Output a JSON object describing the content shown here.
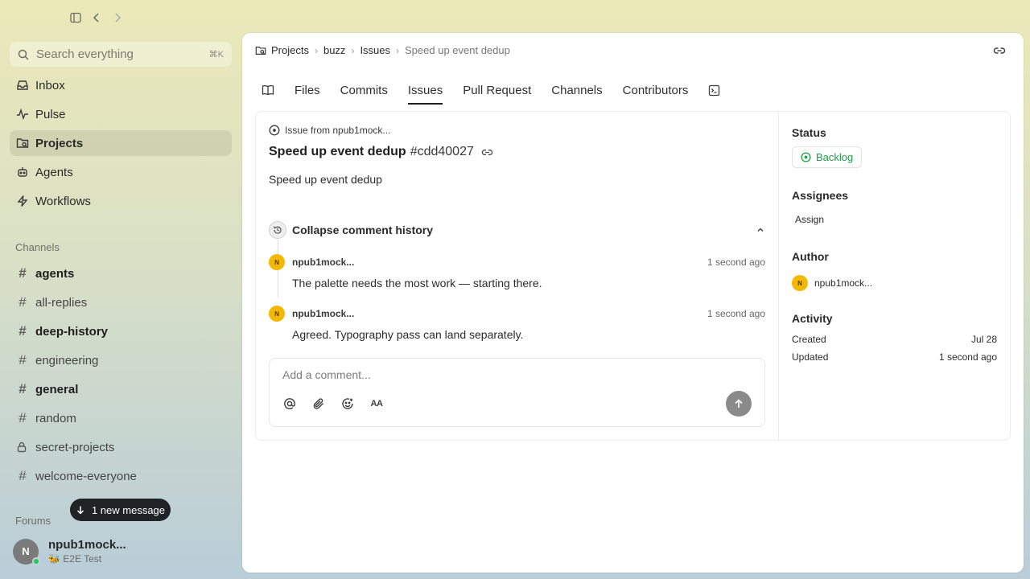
{
  "sidebar": {
    "search_placeholder": "Search everything",
    "search_shortcut": "⌘K",
    "nav": [
      {
        "label": "Inbox",
        "icon": "inbox-icon"
      },
      {
        "label": "Pulse",
        "icon": "pulse-icon"
      },
      {
        "label": "Projects",
        "icon": "projects-icon",
        "active": true
      },
      {
        "label": "Agents",
        "icon": "agents-icon"
      },
      {
        "label": "Workflows",
        "icon": "workflows-icon"
      }
    ],
    "channels_label": "Channels",
    "channels": [
      {
        "name": "agents",
        "unread": true
      },
      {
        "name": "all-replies",
        "unread": false
      },
      {
        "name": "deep-history",
        "unread": true
      },
      {
        "name": "engineering",
        "unread": false
      },
      {
        "name": "general",
        "unread": true
      },
      {
        "name": "random",
        "unread": false
      },
      {
        "name": "secret-projects",
        "unread": false,
        "private": true
      },
      {
        "name": "welcome-everyone",
        "unread": false
      }
    ],
    "forums_label": "Forums",
    "new_message_pill": "1 new message",
    "user": {
      "initial": "N",
      "name": "npub1mock...",
      "status": "🐝 E2E Test"
    }
  },
  "breadcrumb": {
    "items": [
      "Projects",
      "buzz",
      "Issues",
      "Speed up event dedup"
    ]
  },
  "tabs": [
    "Files",
    "Commits",
    "Issues",
    "Pull Request",
    "Channels",
    "Contributors"
  ],
  "active_tab": "Issues",
  "issue": {
    "from_label": "Issue from npub1mock...",
    "title": "Speed up event dedup",
    "id": "#cdd40027",
    "body": "Speed up event dedup",
    "collapse_label": "Collapse comment history",
    "comments": [
      {
        "initial": "N",
        "author": "npub1mock...",
        "time": "1 second ago",
        "text": "The palette needs the most work — starting there."
      },
      {
        "initial": "N",
        "author": "npub1mock...",
        "time": "1 second ago",
        "text": "Agreed. Typography pass can land separately."
      }
    ],
    "comment_placeholder": "Add a comment...",
    "format_label": "AA"
  },
  "details": {
    "status_label": "Status",
    "status_value": "Backlog",
    "status_color": "#1e9e4a",
    "assignees_label": "Assignees",
    "assign_label": "Assign",
    "author_label": "Author",
    "author_initial": "N",
    "author_name": "npub1mock...",
    "activity_label": "Activity",
    "created_label": "Created",
    "created_value": "Jul 28",
    "updated_label": "Updated",
    "updated_value": "1 second ago"
  }
}
